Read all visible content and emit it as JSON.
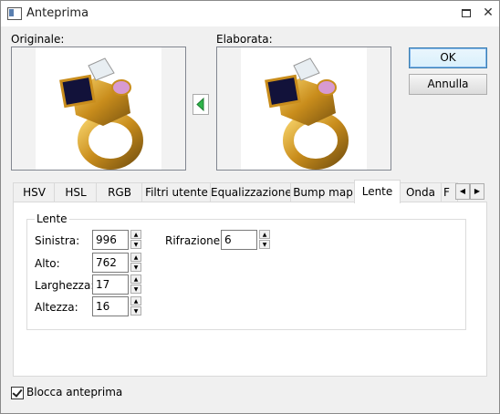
{
  "window": {
    "title": "Anteprima"
  },
  "preview": {
    "original_label": "Originale:",
    "processed_label": "Elaborata:"
  },
  "buttons": {
    "ok": "OK",
    "cancel": "Annulla"
  },
  "tabs": [
    {
      "label": "HSV"
    },
    {
      "label": "HSL"
    },
    {
      "label": "RGB"
    },
    {
      "label": "Filtri utente"
    },
    {
      "label": "Equalizzazione"
    },
    {
      "label": "Bump map"
    },
    {
      "label": "Lente"
    },
    {
      "label": "Onda"
    },
    {
      "label": "F"
    }
  ],
  "active_tab": "Lente",
  "lens": {
    "group_title": "Lente",
    "fields": {
      "sinistra": {
        "label": "Sinistra:",
        "value": "996"
      },
      "alto": {
        "label": "Alto:",
        "value": "762"
      },
      "larghezza": {
        "label": "Larghezza:",
        "value": "17"
      },
      "altezza": {
        "label": "Altezza:",
        "value": "16"
      },
      "rifrazione": {
        "label": "Rifrazione:",
        "value": "6"
      }
    }
  },
  "lock_preview": {
    "label": "Blocca anteprima",
    "checked": true
  },
  "colors": {
    "arrow": "#2fb54a",
    "gold": "#d8a22a",
    "accent": "#3c7fb1"
  },
  "icons": [
    "window-icon",
    "maximize-icon",
    "close-icon",
    "green-left-arrow-icon",
    "spin-up-icon",
    "spin-down-icon",
    "tab-scroll-left-icon",
    "tab-scroll-right-icon",
    "checkmark-icon"
  ]
}
